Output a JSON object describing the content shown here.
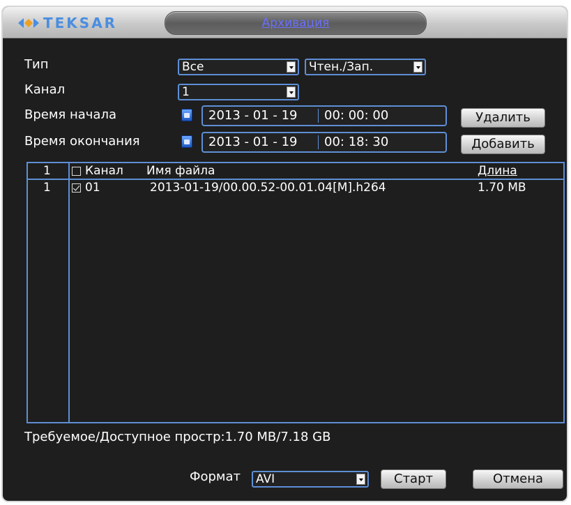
{
  "brand": {
    "logo_text": "TEKSAR"
  },
  "window": {
    "title": "Архивация"
  },
  "filters": {
    "type_label": "Тип",
    "type_value": "Все",
    "mode_value": "Чтен./Зап.",
    "channel_label": "Канал",
    "channel_value": "1",
    "start_label": "Время начала",
    "start_date": "2013 - 01 - 19",
    "start_time": "00: 00: 00",
    "end_label": "Время окончания",
    "end_date": "2013 - 01 - 19",
    "end_time": "00: 18: 30",
    "delete_label": "Удалить",
    "add_label": "Добавить"
  },
  "table": {
    "header": {
      "index": "1",
      "channel": "Канал",
      "filename": "Имя файла",
      "length": "Длина"
    },
    "rows": [
      {
        "index": "1",
        "channel": "01",
        "filename": "2013-01-19/00.00.52-00.01.04[M].h264",
        "length": "1.70 MB",
        "checked": true
      }
    ]
  },
  "space": {
    "text": "Требуемое/Доступное простр:1.70 MB/7.18 GB"
  },
  "footer": {
    "format_label": "Формат",
    "format_value": "AVI",
    "start_label": "Старт",
    "cancel_label": "Отмена"
  },
  "colors": {
    "accent": "#5e8fd6",
    "title": "#6a70ff",
    "background": "#1e1e1e"
  }
}
